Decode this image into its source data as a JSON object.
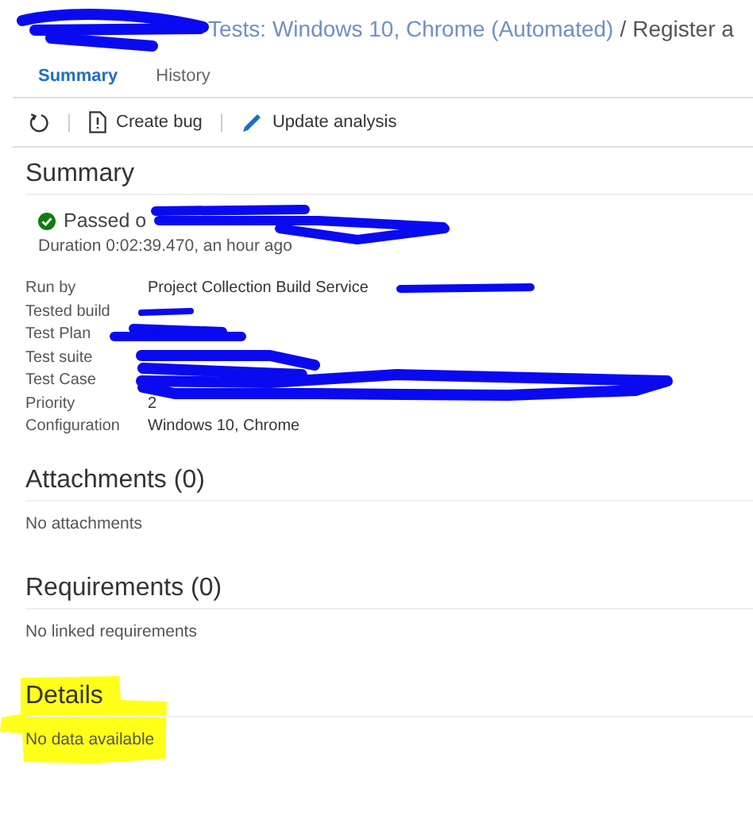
{
  "breadcrumb": {
    "link": "Tests: Windows 10, Chrome (Automated)",
    "separator": "/",
    "current": "Register a"
  },
  "tabs": [
    {
      "label": "Summary",
      "selected": true
    },
    {
      "label": "History",
      "selected": false
    }
  ],
  "toolbar": [
    {
      "kind": "refresh"
    },
    {
      "kind": "bug",
      "label": "Create bug"
    },
    {
      "kind": "pencil",
      "label": "Update analysis"
    }
  ],
  "summary": {
    "title": "Summary",
    "outcome": "Passed o",
    "passed": true,
    "duration": "Duration 0:02:39.470, an hour ago",
    "fields": [
      {
        "label": "Run by",
        "value": "Project Collection Build Service"
      },
      {
        "label": "Tested build"
      },
      {
        "label": "Test Plan"
      },
      {
        "label": "Test suite"
      },
      {
        "label": "Test Case"
      },
      {
        "label": "Priority",
        "value": "2"
      },
      {
        "label": "Configuration",
        "value": "Windows 10, Chrome"
      }
    ]
  },
  "sections": [
    {
      "title": "Attachments (0)",
      "text": "No attachments",
      "highlighted": false
    },
    {
      "title": "Requirements (0)",
      "text": "No linked requirements",
      "highlighted": false
    },
    {
      "title": "Details",
      "text": "No data available",
      "highlighted": true
    }
  ]
}
